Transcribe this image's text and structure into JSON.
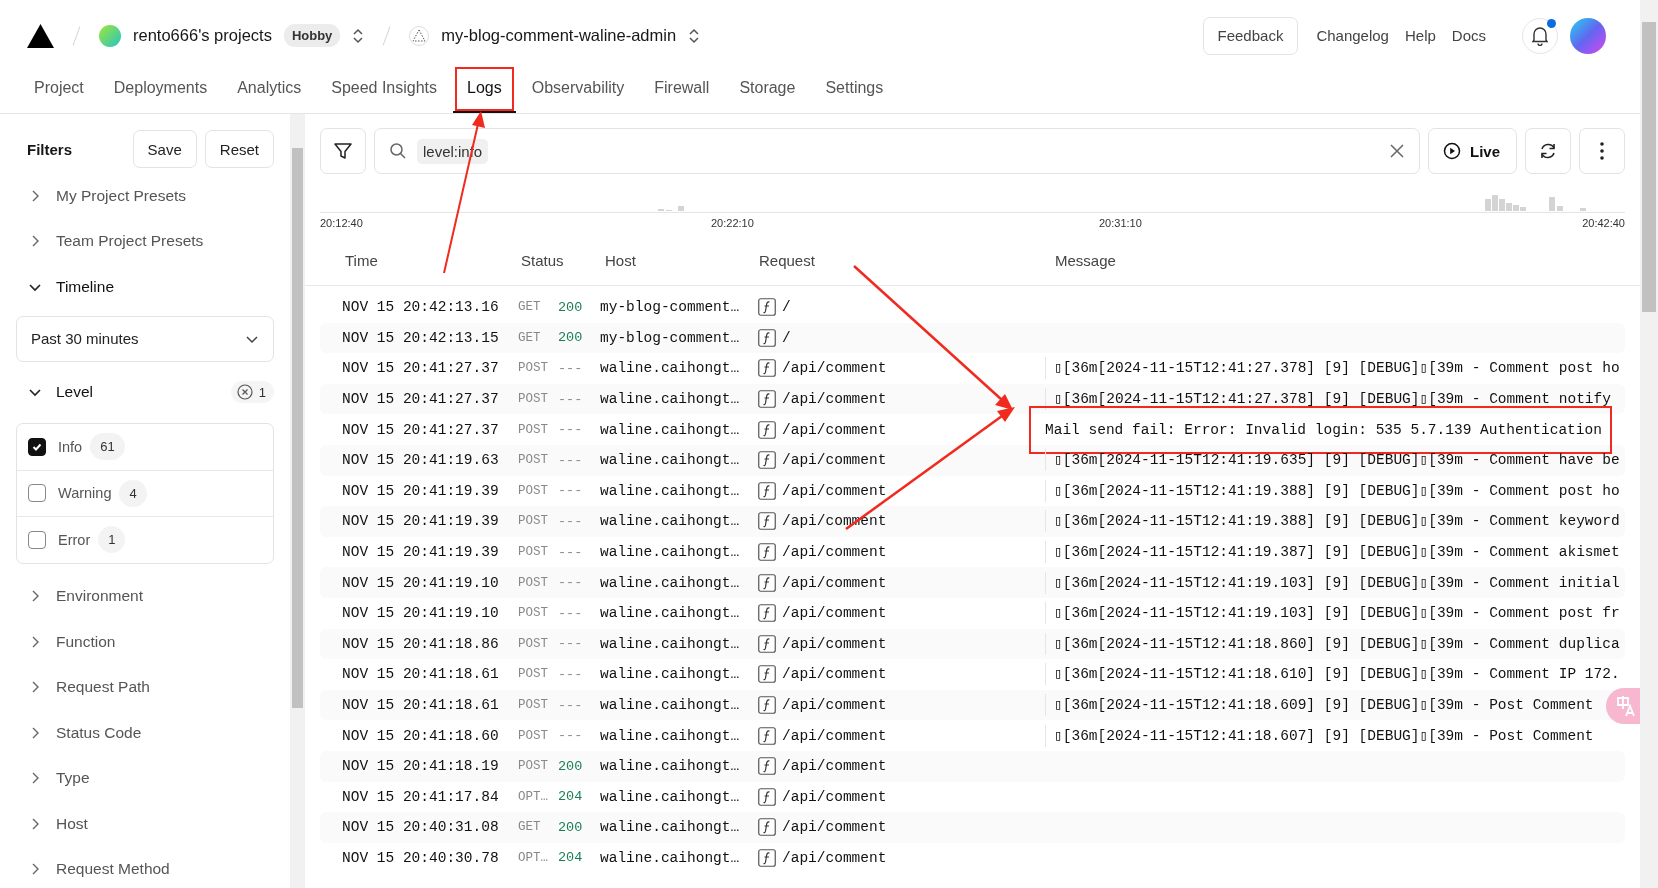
{
  "header": {
    "team": {
      "name": "rento666's projects",
      "plan": "Hobby"
    },
    "project": {
      "name": "my-blog-comment-waline-admin"
    },
    "feedback": "Feedback",
    "links": [
      "Changelog",
      "Help",
      "Docs"
    ],
    "notifications": {
      "unread": true
    }
  },
  "tabs": [
    {
      "label": "Project",
      "selected": false,
      "highlighted": false
    },
    {
      "label": "Deployments",
      "selected": false,
      "highlighted": false
    },
    {
      "label": "Analytics",
      "selected": false,
      "highlighted": false
    },
    {
      "label": "Speed Insights",
      "selected": false,
      "highlighted": false
    },
    {
      "label": "Logs",
      "selected": true,
      "highlighted": true
    },
    {
      "label": "Observability",
      "selected": false,
      "highlighted": false
    },
    {
      "label": "Firewall",
      "selected": false,
      "highlighted": false
    },
    {
      "label": "Storage",
      "selected": false,
      "highlighted": false
    },
    {
      "label": "Settings",
      "selected": false,
      "highlighted": false
    }
  ],
  "filters": {
    "title": "Filters",
    "save": "Save",
    "reset": "Reset",
    "sections": [
      {
        "kind": "group",
        "label": "My Project Presets",
        "expanded": false
      },
      {
        "kind": "group",
        "label": "Team Project Presets",
        "expanded": false
      },
      {
        "kind": "timeline",
        "label": "Timeline",
        "expanded": true,
        "value": "Past 30 minutes"
      },
      {
        "kind": "level",
        "label": "Level",
        "expanded": true,
        "clear_count": "1",
        "options": [
          {
            "label": "Info",
            "count": "61",
            "checked": true
          },
          {
            "label": "Warning",
            "count": "4",
            "checked": false
          },
          {
            "label": "Error",
            "count": "1",
            "checked": false
          }
        ]
      },
      {
        "kind": "group",
        "label": "Environment",
        "expanded": false
      },
      {
        "kind": "group",
        "label": "Function",
        "expanded": false
      },
      {
        "kind": "group",
        "label": "Request Path",
        "expanded": false
      },
      {
        "kind": "group",
        "label": "Status Code",
        "expanded": false
      },
      {
        "kind": "group",
        "label": "Type",
        "expanded": false
      },
      {
        "kind": "group",
        "label": "Host",
        "expanded": false
      },
      {
        "kind": "group",
        "label": "Request Method",
        "expanded": false
      }
    ]
  },
  "toolbar": {
    "query": "level:info",
    "live": "Live"
  },
  "histogram": {
    "ticks": [
      "20:12:40",
      "20:22:10",
      "20:31:10",
      "20:42:40"
    ]
  },
  "columns": [
    "Time",
    "Status",
    "Host",
    "Request",
    "Message"
  ],
  "rows": [
    {
      "time": "NOV 15 20:42:13.16",
      "method": "GET",
      "status": "200",
      "status_ok": true,
      "host": "my-blog-comment…",
      "path": "/",
      "highlighted": false
    },
    {
      "time": "NOV 15 20:42:13.15",
      "method": "GET",
      "status": "200",
      "status_ok": true,
      "host": "my-blog-comment…",
      "path": "/",
      "highlighted": false
    },
    {
      "time": "NOV 15 20:41:27.37",
      "method": "POST",
      "status": "---",
      "status_ok": false,
      "host": "waline.caihongt…",
      "path": "/api/comment",
      "message": "▯[36m[2024-11-15T12:41:27.378] [9] [DEBUG]▯[39m - Comment post ho",
      "highlighted": false
    },
    {
      "time": "NOV 15 20:41:27.37",
      "method": "POST",
      "status": "---",
      "status_ok": false,
      "host": "waline.caihongt…",
      "path": "/api/comment",
      "message": "▯[36m[2024-11-15T12:41:27.378] [9] [DEBUG]▯[39m - Comment notify",
      "highlighted": false
    },
    {
      "time": "NOV 15 20:41:27.37",
      "method": "POST",
      "status": "---",
      "status_ok": false,
      "host": "waline.caihongt…",
      "path": "/api/comment",
      "message": "Mail send fail: Error: Invalid login: 535 5.7.139 Authentication",
      "highlighted": true
    },
    {
      "time": "NOV 15 20:41:19.63",
      "method": "POST",
      "status": "---",
      "status_ok": false,
      "host": "waline.caihongt…",
      "path": "/api/comment",
      "message": "▯[36m[2024-11-15T12:41:19.635] [9] [DEBUG]▯[39m - Comment have be",
      "highlighted": false
    },
    {
      "time": "NOV 15 20:41:19.39",
      "method": "POST",
      "status": "---",
      "status_ok": false,
      "host": "waline.caihongt…",
      "path": "/api/comment",
      "message": "▯[36m[2024-11-15T12:41:19.388] [9] [DEBUG]▯[39m - Comment post ho",
      "highlighted": false
    },
    {
      "time": "NOV 15 20:41:19.39",
      "method": "POST",
      "status": "---",
      "status_ok": false,
      "host": "waline.caihongt…",
      "path": "/api/comment",
      "message": "▯[36m[2024-11-15T12:41:19.388] [9] [DEBUG]▯[39m - Comment keyword",
      "highlighted": false
    },
    {
      "time": "NOV 15 20:41:19.39",
      "method": "POST",
      "status": "---",
      "status_ok": false,
      "host": "waline.caihongt…",
      "path": "/api/comment",
      "message": "▯[36m[2024-11-15T12:41:19.387] [9] [DEBUG]▯[39m - Comment akismet",
      "highlighted": false
    },
    {
      "time": "NOV 15 20:41:19.10",
      "method": "POST",
      "status": "---",
      "status_ok": false,
      "host": "waline.caihongt…",
      "path": "/api/comment",
      "message": "▯[36m[2024-11-15T12:41:19.103] [9] [DEBUG]▯[39m - Comment initial",
      "highlighted": false
    },
    {
      "time": "NOV 15 20:41:19.10",
      "method": "POST",
      "status": "---",
      "status_ok": false,
      "host": "waline.caihongt…",
      "path": "/api/comment",
      "message": "▯[36m[2024-11-15T12:41:19.103] [9] [DEBUG]▯[39m - Comment post fr",
      "highlighted": false
    },
    {
      "time": "NOV 15 20:41:18.86",
      "method": "POST",
      "status": "---",
      "status_ok": false,
      "host": "waline.caihongt…",
      "path": "/api/comment",
      "message": "▯[36m[2024-11-15T12:41:18.860] [9] [DEBUG]▯[39m - Comment duplica",
      "highlighted": false
    },
    {
      "time": "NOV 15 20:41:18.61",
      "method": "POST",
      "status": "---",
      "status_ok": false,
      "host": "waline.caihongt…",
      "path": "/api/comment",
      "message": "▯[36m[2024-11-15T12:41:18.610] [9] [DEBUG]▯[39m - Comment IP 172.",
      "highlighted": false
    },
    {
      "time": "NOV 15 20:41:18.61",
      "method": "POST",
      "status": "---",
      "status_ok": false,
      "host": "waline.caihongt…",
      "path": "/api/comment",
      "message": "▯[36m[2024-11-15T12:41:18.609] [9] [DEBUG]▯[39m - Post Comment",
      "highlighted": false
    },
    {
      "time": "NOV 15 20:41:18.60",
      "method": "POST",
      "status": "---",
      "status_ok": false,
      "host": "waline.caihongt…",
      "path": "/api/comment",
      "message": "▯[36m[2024-11-15T12:41:18.607] [9] [DEBUG]▯[39m - Post Comment",
      "highlighted": false
    },
    {
      "time": "NOV 15 20:41:18.19",
      "method": "POST",
      "status": "200",
      "status_ok": true,
      "host": "waline.caihongt…",
      "path": "/api/comment",
      "highlighted": false
    },
    {
      "time": "NOV 15 20:41:17.84",
      "method": "OPT…",
      "status": "204",
      "status_ok": true,
      "host": "waline.caihongt…",
      "path": "/api/comment",
      "highlighted": false
    },
    {
      "time": "NOV 15 20:40:31.08",
      "method": "GET",
      "status": "200",
      "status_ok": true,
      "host": "waline.caihongt…",
      "path": "/api/comment",
      "highlighted": false
    },
    {
      "time": "NOV 15 20:40:30.78",
      "method": "OPT…",
      "status": "204",
      "status_ok": true,
      "host": "waline.caihongt…",
      "path": "/api/comment",
      "highlighted": false
    }
  ]
}
